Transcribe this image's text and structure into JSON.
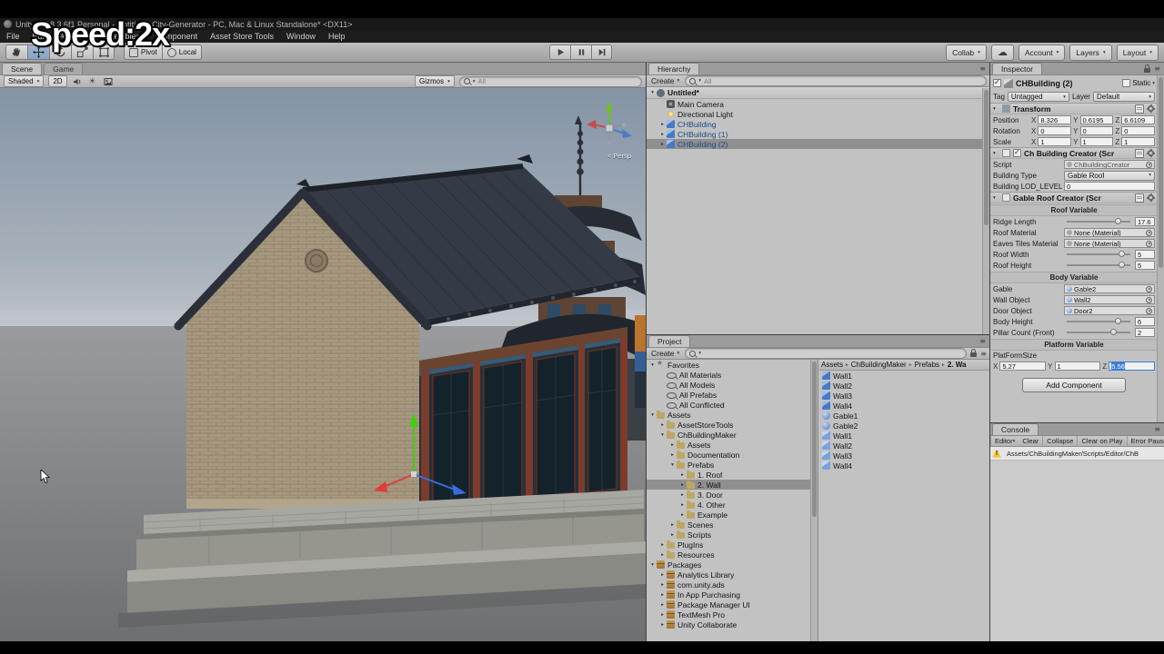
{
  "overlay": {
    "speed_label": "Speed:2x"
  },
  "title_bar": {
    "title": "Unity 2018.3.6f1 Personal - Untitled - City-Generator - PC, Mac & Linux Standalone* <DX11>"
  },
  "menu_bar": {
    "items": [
      {
        "label": "File"
      },
      {
        "label": "Edit"
      },
      {
        "label": "Assets"
      },
      {
        "label": "GameObject"
      },
      {
        "label": "Component"
      },
      {
        "label": "Asset Store Tools"
      },
      {
        "label": "Window"
      },
      {
        "label": "Help"
      }
    ]
  },
  "toolbar": {
    "pivot_label": "Pivot",
    "local_label": "Local",
    "collab_label": "Collab",
    "account_label": "Account",
    "layers_label": "Layers",
    "layout_label": "Layout"
  },
  "scene_view": {
    "tabs": [
      {
        "label": "Scene",
        "active": true
      },
      {
        "label": "Game"
      }
    ],
    "shading_mode": "Shaded",
    "toggle_2d_label": "2D",
    "gizmos_label": "Gizmos",
    "search_hint": "All",
    "persp_label": "< Persp"
  },
  "hierarchy": {
    "tab_label": "Hierarchy",
    "create_label": "Create",
    "search_hint": "All",
    "scene_row_label": "Untitled*",
    "items": [
      {
        "label": "Main Camera",
        "depth": 1,
        "icon": "camera"
      },
      {
        "label": "Directional Light",
        "depth": 1,
        "icon": "light"
      },
      {
        "label": "CHBuilding",
        "depth": 1,
        "icon": "prefab",
        "exp": false,
        "prefab": true
      },
      {
        "label": "CHBuilding (1)",
        "depth": 1,
        "icon": "prefab",
        "exp": false,
        "prefab": true
      },
      {
        "label": "CHBuilding (2)",
        "depth": 1,
        "icon": "prefab",
        "exp": false,
        "prefab": true,
        "selected": true
      }
    ]
  },
  "project": {
    "tab_label": "Project",
    "create_label": "Create",
    "search_hint": "",
    "breadcrumb": [
      {
        "label": "Assets"
      },
      {
        "label": "ChBuildingMaker"
      },
      {
        "label": "Prefabs"
      },
      {
        "label": "2. Wa",
        "current": true
      }
    ],
    "tree": [
      {
        "label": "Favorites",
        "depth": 0,
        "icon": "star",
        "exp": true
      },
      {
        "label": "All Materials",
        "depth": 1,
        "icon": "search"
      },
      {
        "label": "All Models",
        "depth": 1,
        "icon": "search"
      },
      {
        "label": "All Prefabs",
        "depth": 1,
        "icon": "search"
      },
      {
        "label": "All Conflicted",
        "depth": 1,
        "icon": "search"
      },
      {
        "label": "Assets",
        "depth": 0,
        "icon": "folder",
        "exp": true
      },
      {
        "label": "AssetStoreTools",
        "depth": 1,
        "icon": "folder",
        "exp": false
      },
      {
        "label": "ChBuildingMaker",
        "depth": 1,
        "icon": "folder",
        "exp": true
      },
      {
        "label": "Assets",
        "depth": 2,
        "icon": "folder",
        "exp": false
      },
      {
        "label": "Documentation",
        "depth": 2,
        "icon": "folder",
        "exp": false
      },
      {
        "label": "Prefabs",
        "depth": 2,
        "icon": "folder",
        "exp": true
      },
      {
        "label": "1. Roof",
        "depth": 3,
        "icon": "folder",
        "exp": false
      },
      {
        "label": "2. Wall",
        "depth": 3,
        "icon": "folder",
        "exp": false,
        "selected": true
      },
      {
        "label": "3. Door",
        "depth": 3,
        "icon": "folder",
        "exp": false
      },
      {
        "label": "4. Other",
        "depth": 3,
        "icon": "folder",
        "exp": false
      },
      {
        "label": "Example",
        "depth": 3,
        "icon": "folder",
        "exp": false
      },
      {
        "label": "Scenes",
        "depth": 2,
        "icon": "folder",
        "exp": false
      },
      {
        "label": "Scripts",
        "depth": 2,
        "icon": "folder",
        "exp": false
      },
      {
        "label": "PlugIns",
        "depth": 1,
        "icon": "folder",
        "exp": false
      },
      {
        "label": "Resources",
        "depth": 1,
        "icon": "folder",
        "exp": false
      },
      {
        "label": "Packages",
        "depth": 0,
        "icon": "package",
        "exp": true
      },
      {
        "label": "Analytics Library",
        "depth": 1,
        "icon": "package",
        "exp": false
      },
      {
        "label": "com.unity.ads",
        "depth": 1,
        "icon": "package",
        "exp": false
      },
      {
        "label": "In App Purchasing",
        "depth": 1,
        "icon": "package",
        "exp": false
      },
      {
        "label": "Package Manager UI",
        "depth": 1,
        "icon": "package",
        "exp": false
      },
      {
        "label": "TextMesh Pro",
        "depth": 1,
        "icon": "package",
        "exp": false
      },
      {
        "label": "Unity Collaborate",
        "depth": 1,
        "icon": "package",
        "exp": false
      }
    ],
    "files": [
      {
        "label": "Wall1",
        "icon": "prefab"
      },
      {
        "label": "Wall2",
        "icon": "prefab"
      },
      {
        "label": "Wall3",
        "icon": "prefab"
      },
      {
        "label": "Wall4",
        "icon": "prefab"
      },
      {
        "label": "Gable1",
        "icon": "gable"
      },
      {
        "label": "Gable2",
        "icon": "gable"
      },
      {
        "label": "Wall1",
        "icon": "prefab2"
      },
      {
        "label": "Wall2",
        "icon": "prefab2"
      },
      {
        "label": "Wall3",
        "icon": "prefab2"
      },
      {
        "label": "Wall4",
        "icon": "prefab2"
      }
    ]
  },
  "inspector": {
    "tab_label": "Inspector",
    "header": {
      "name": "CHBuilding (2)",
      "static_label": "Static"
    },
    "tag_label": "Tag",
    "tag_value": "Untagged",
    "layer_label": "Layer",
    "layer_value": "Default",
    "transform": {
      "title": "Transform",
      "axis": {
        "x": "X",
        "y": "Y",
        "z": "Z"
      },
      "position": {
        "label": "Position",
        "x": "8.326",
        "y": "0.6195",
        "z": "6.6109"
      },
      "rotation": {
        "label": "Rotation",
        "x": "0",
        "y": "0",
        "z": "0"
      },
      "scale": {
        "label": "Scale",
        "x": "1",
        "y": "1",
        "z": "1"
      }
    },
    "ch_building_creator": {
      "title": "Ch Building Creator (Scr",
      "script_label": "Script",
      "script_value": "ChBuildingCreator",
      "building_type_label": "Building Type",
      "building_type_value": "Gable Roof",
      "lod_label": "Building LOD_LEVEL",
      "lod_value": "0"
    },
    "gable_roof_creator": {
      "title": "Gable Roof Creator (Scr",
      "section_roof": "Roof Variable",
      "ridge_length": {
        "label": "Ridge Length",
        "value": "17.6",
        "frac": 0.86
      },
      "roof_material": {
        "label": "Roof Material",
        "value": "None (Material)"
      },
      "eaves_material": {
        "label": "Eaves Tiles Material",
        "value": "None (Material)"
      },
      "roof_width": {
        "label": "Roof Width",
        "value": "5",
        "frac": 0.93
      },
      "roof_height": {
        "label": "Roof Height",
        "value": "5",
        "frac": 0.93
      },
      "section_body": "Body Variable",
      "gable_object": {
        "label": "Gable",
        "value": "Gable2"
      },
      "wall_object": {
        "label": "Wall Object",
        "value": "Wall2"
      },
      "door_object": {
        "label": "Door Object",
        "value": "Door2"
      },
      "body_height": {
        "label": "Body Height",
        "value": "6",
        "frac": 0.86
      },
      "pillar_count": {
        "label": "Pillar Count (Front)",
        "value": "2",
        "frac": 0.78
      },
      "section_platform": "Platform Variable",
      "platform_size_label": "PlatFormSize",
      "platform_x_label": "X",
      "platform_x": "5.27",
      "platform_y_label": "Y",
      "platform_y": "1",
      "platform_z_label": "Z",
      "platform_z": "5.56"
    },
    "add_component_label": "Add Component"
  },
  "console": {
    "tab_label": "Console",
    "buttons": [
      {
        "label": "Clear"
      },
      {
        "label": "Collapse"
      },
      {
        "label": "Clear on Play"
      },
      {
        "label": "Error Pause"
      }
    ],
    "editor_label": "Editor",
    "entries": [
      {
        "icon": "warning",
        "text": "Assets/ChBuildingMaker/Scripts/Editor/ChB"
      }
    ]
  },
  "colors": {
    "selection_focused": "#3d7cd6",
    "selection_unfocused": "#8f8f8f",
    "warning_yellow": "#f2c530",
    "prefab_text_blue": "#1d4a85"
  }
}
